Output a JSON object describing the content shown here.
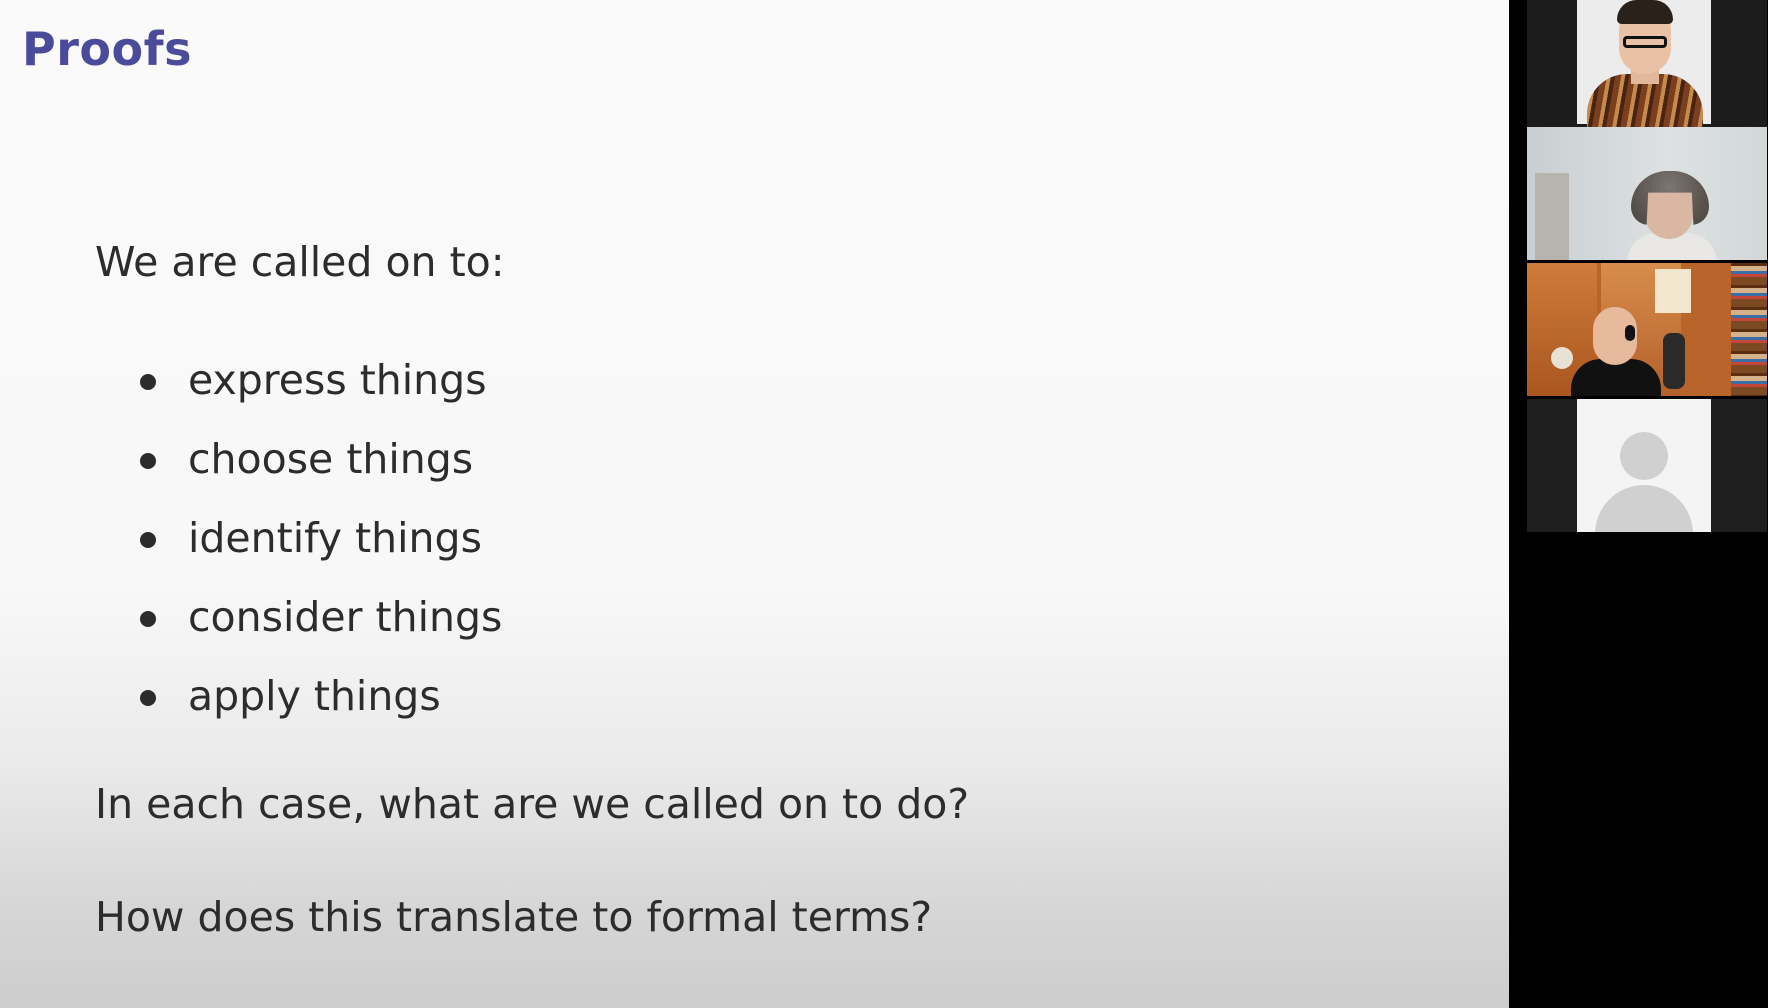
{
  "slide": {
    "title": "Proofs",
    "intro": "We are called on to:",
    "bullets": [
      "express things",
      "choose things",
      "identify things",
      "consider things",
      "apply things"
    ],
    "question_1": "In each case, what are we called on to do?",
    "question_2": "How does this translate to formal terms?"
  },
  "colors": {
    "title_color": "#4b4b9b",
    "text_color": "#2c2c2c",
    "panel_background": "#000000"
  },
  "participants": [
    {
      "tile": "video",
      "icon": "person-glasses"
    },
    {
      "tile": "video",
      "icon": "person-grey-hair"
    },
    {
      "tile": "video",
      "icon": "person-headset"
    },
    {
      "tile": "avatar",
      "icon": "default-avatar-icon"
    }
  ]
}
